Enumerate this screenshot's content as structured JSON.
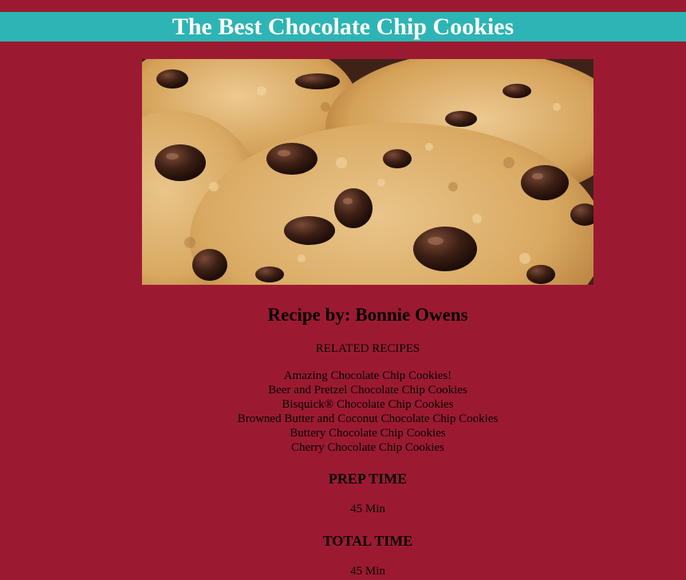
{
  "header": {
    "title": "The Best Chocolate Chip Cookies"
  },
  "hero_image": {
    "alt": "Close-up photo of chocolate chip cookies",
    "icon": "cookie-photo"
  },
  "recipe": {
    "byline": "Recipe by: Bonnie Owens",
    "related_heading": "RELATED RECIPES",
    "related": [
      "Amazing Chocolate Chip Cookies!",
      "Beer and Pretzel Chocolate Chip Cookies",
      "Bisquick® Chocolate Chip Cookies",
      "Browned Butter and Coconut Chocolate Chip Cookies",
      "Buttery Chocolate Chip Cookies",
      "Cherry Chocolate Chip Cookies"
    ],
    "prep_time_label": "PREP TIME",
    "prep_time_value": "45 Min",
    "total_time_label": "TOTAL TIME",
    "total_time_value": "45 Min"
  },
  "colors": {
    "page_background": "#9c1a31",
    "title_bar": "#2db4b4",
    "title_text": "#ffffff"
  }
}
